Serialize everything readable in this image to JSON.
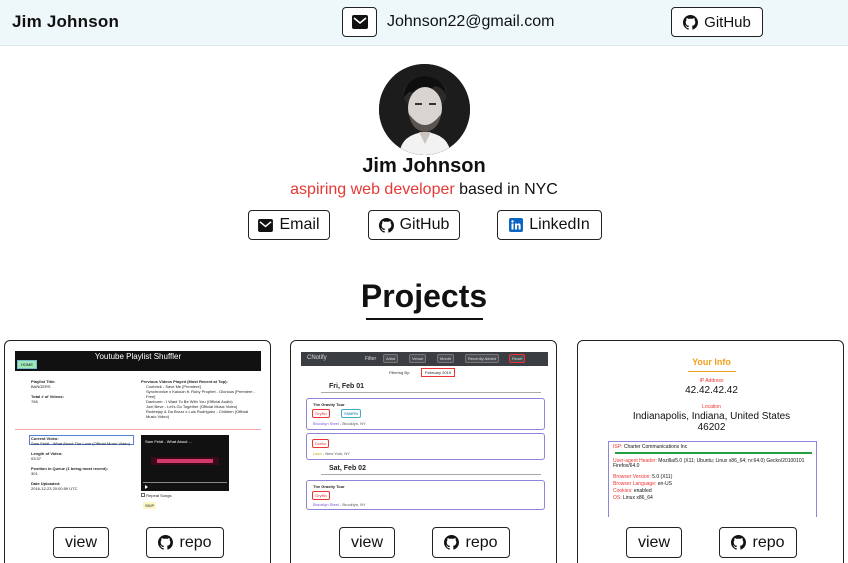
{
  "header": {
    "brand": "Jim Johnson",
    "email": "Johnson22@gmail.com",
    "github_label": "GitHub"
  },
  "hero": {
    "name": "Jim Johnson",
    "tagline_accent": "aspiring web developer",
    "tagline_rest": " based in NYC",
    "buttons": {
      "email": "Email",
      "github": "GitHub",
      "linkedin": "LinkedIn"
    }
  },
  "projects": {
    "title": "Projects",
    "cards": [
      {
        "view_label": "view",
        "repo_label": "repo"
      },
      {
        "view_label": "view",
        "repo_label": "repo"
      },
      {
        "view_label": "view",
        "repo_label": "repo"
      }
    ]
  },
  "shot1": {
    "title": "Youtube Playlist Shuffler",
    "home": "HOME",
    "left_lines": [
      "Playlist Title:",
      "BANGERS",
      "",
      "Total # of Videos:",
      "766"
    ],
    "prev_head": "Previous Videos Played (Most Recent at Top):",
    "prev_items": [
      "Cuebrick - Save Me [Premiere]",
      "Synchronice x Kaiouin ft. Ruby Prophet - Glorious [Premiere - Free]",
      "Danburm - I Want To Be With You (Official Audio)",
      "Joel Beve - Let's Go Together (Official Music Video)",
      "Rudeejay & Da Brozz x Luis Rodriguez - Children (Official Music Video)"
    ],
    "current_label": "Current Video:",
    "current_value": "Sam Feldt - What About The Love (Official Music Video)",
    "length_label": "Length of Video:",
    "length_value": "03:37",
    "position_label": "Position in Queue (1 being most recent):",
    "position_value": "301",
    "date_label": "Date Uploaded:",
    "date_value": "2016-12-23 20:00:59 UTC",
    "repeat": "Repeat Songs",
    "skip": "SKIP",
    "video_title": "Sam Feldt - What About ..."
  },
  "shot2": {
    "brand": "CNotify",
    "nav": [
      "Filter",
      "Artist",
      "Venue",
      "Month",
      "Recently Added",
      "Reset"
    ],
    "filtering_by": "Filtering By:",
    "month": "February 2019",
    "day1": "Fri, Feb 01",
    "day2": "Sat, Feb 02",
    "events": [
      {
        "title": "The Gravity Tour",
        "tags": [
          "Gryffin",
          "SNBRN"
        ],
        "venue": "Brooklyn Steel",
        "city": " - Brooklyn, NY"
      },
      {
        "title": "",
        "tags": [
          "Dzeko"
        ],
        "venue": "Lavo",
        "city": " - New York, NY"
      },
      {
        "title": "The Gravity Tour",
        "tags": [
          "Gryffin"
        ],
        "venue": "Brooklyn Steel",
        "city": " - Brooklyn, NY"
      }
    ]
  },
  "shot3": {
    "title": "Your Info",
    "ip_label": "IP Address",
    "ip_value": "42.42.42.42",
    "loc_label": "Location",
    "loc_value_1": "Indianapolis, Indiana, United States",
    "loc_value_2": "46202",
    "rows": [
      {
        "k": "ISP:",
        "v": " Charter Communications Inc"
      },
      {
        "k": "User-agent Header:",
        "v": " Mozilla/5.0 (X11; Ubuntu; Linux x86_64; rv:64.0) Gecko/20100101 Firefox/64.0"
      },
      {
        "k": "Browser Version:",
        "v": " 5.0 (X11)"
      },
      {
        "k": "Browser Language:",
        "v": " en-US"
      },
      {
        "k": "Cookies:",
        "v": " enabled"
      },
      {
        "k": "OS:",
        "v": " Linux x86_64"
      }
    ]
  },
  "colors": {
    "accent": "#e53935",
    "topbar_bg": "#eef8fb",
    "linkedin": "#0a66c2"
  },
  "icons": [
    "envelope-icon",
    "github-icon",
    "linkedin-icon"
  ]
}
